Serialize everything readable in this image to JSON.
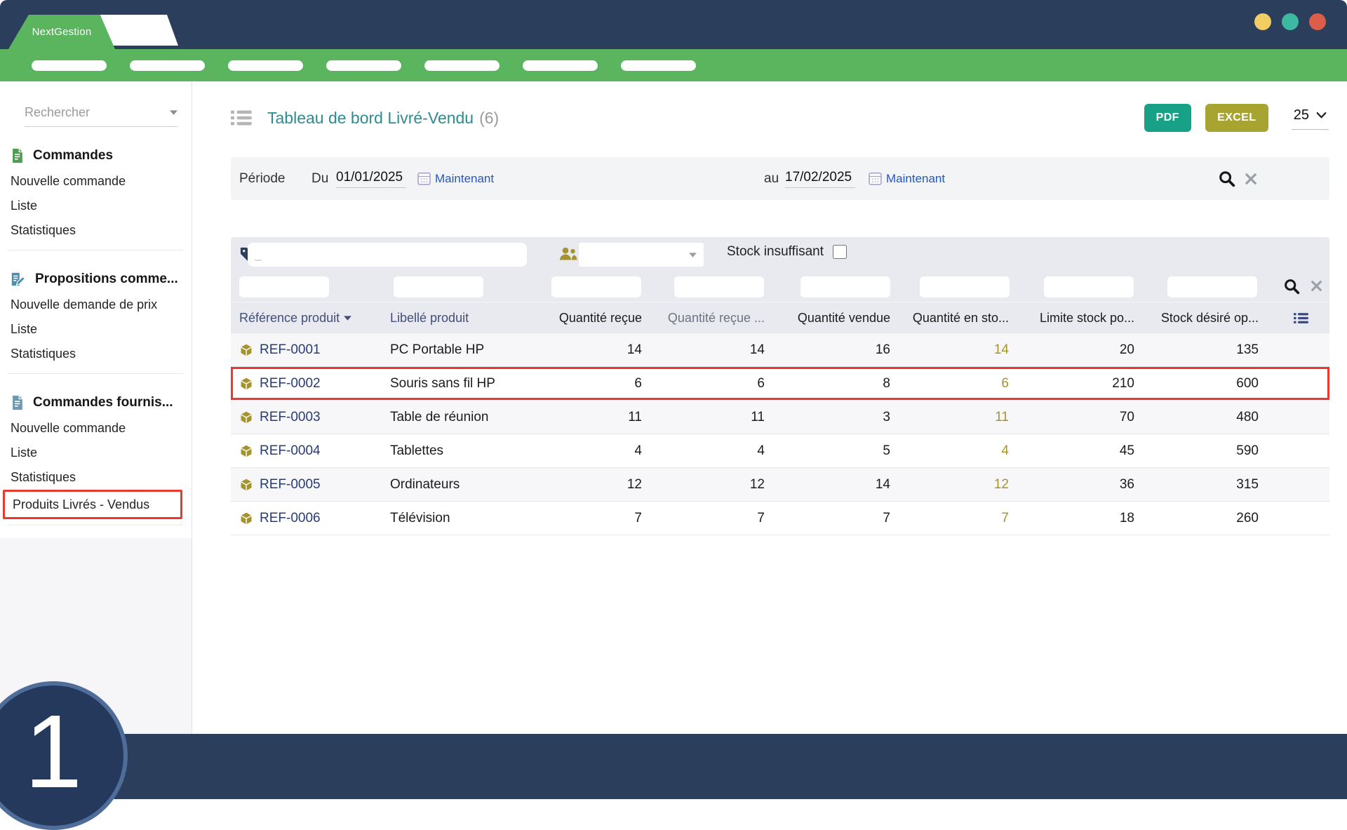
{
  "window": {
    "brand": "NextGestion",
    "dot_colors": [
      "#f0ce63",
      "#3db8a1",
      "#dc5d49"
    ]
  },
  "nav": {
    "pill_count": 7
  },
  "sidebar": {
    "search_placeholder": "Rechercher",
    "sections": [
      {
        "title": "Commandes",
        "icon": "orders-document-icon",
        "items": [
          "Nouvelle commande",
          "Liste",
          "Statistiques"
        ]
      },
      {
        "title": "Propositions comme...",
        "icon": "proposal-edit-icon",
        "items": [
          "Nouvelle demande de prix",
          "Liste",
          "Statistiques"
        ]
      },
      {
        "title": "Commandes fournis...",
        "icon": "supplier-document-icon",
        "items": [
          "Nouvelle commande",
          "Liste",
          "Statistiques",
          "Produits Livrés - Vendus"
        ]
      }
    ]
  },
  "header": {
    "title": "Tableau de bord Livré-Vendu",
    "count": "(6)",
    "pdf_label": "PDF",
    "excel_label": "EXCEL",
    "page_size": "25"
  },
  "period": {
    "label": "Période",
    "from_label": "Du",
    "from_value": "01/01/2025",
    "from_now_label": "Maintenant",
    "to_label": "au",
    "to_value": "17/02/2025",
    "to_now_label": "Maintenant"
  },
  "filters": {
    "tag_input_value": "",
    "tag_input_placeholder": "_",
    "supplier_select_value": "",
    "stock_checkbox_label": "Stock insuffisant",
    "stock_checked": false
  },
  "table": {
    "columns": [
      "Référence produit",
      "Libellé produit",
      "Quantité reçue",
      "Quantité reçue ...",
      "Quantité vendue",
      "Quantité en sto...",
      "Limite stock po...",
      "Stock désiré op..."
    ],
    "rows": [
      {
        "ref": "REF-0001",
        "product": "PC Portable HP",
        "qty_received": "14",
        "qty_received2": "14",
        "qty_sold": "16",
        "qty_stock": "14",
        "stock_limit": "20",
        "stock_desired": "135"
      },
      {
        "ref": "REF-0002",
        "product": "Souris sans fil HP",
        "qty_received": "6",
        "qty_received2": "6",
        "qty_sold": "8",
        "qty_stock": "6",
        "stock_limit": "210",
        "stock_desired": "600"
      },
      {
        "ref": "REF-0003",
        "product": "Table de réunion",
        "qty_received": "11",
        "qty_received2": "11",
        "qty_sold": "3",
        "qty_stock": "11",
        "stock_limit": "70",
        "stock_desired": "480"
      },
      {
        "ref": "REF-0004",
        "product": "Tablettes",
        "qty_received": "4",
        "qty_received2": "4",
        "qty_sold": "5",
        "qty_stock": "4",
        "stock_limit": "45",
        "stock_desired": "590"
      },
      {
        "ref": "REF-0005",
        "product": "Ordinateurs",
        "qty_received": "12",
        "qty_received2": "12",
        "qty_sold": "14",
        "qty_stock": "12",
        "stock_limit": "36",
        "stock_desired": "315"
      },
      {
        "ref": "REF-0006",
        "product": "Télévision",
        "qty_received": "7",
        "qty_received2": "7",
        "qty_sold": "7",
        "qty_stock": "7",
        "stock_limit": "18",
        "stock_desired": "260"
      }
    ]
  },
  "annotations": {
    "highlighted_row_ref": "REF-0002",
    "highlighted_sidebar_item": "Produits Livrés - Vendus",
    "annotation_color": "#e6392f",
    "step_number": "1"
  },
  "colors": {
    "navy": "#2b3e5c",
    "green": "#5ab55e",
    "title_teal": "#2e8b8e",
    "link_blue": "#2256c7",
    "pdf_button": "#17a287",
    "excel_button": "#a8a431",
    "gold_accent": "#a5942e",
    "ref_link_navy": "#263c77",
    "annotation_red": "#e6392f"
  }
}
